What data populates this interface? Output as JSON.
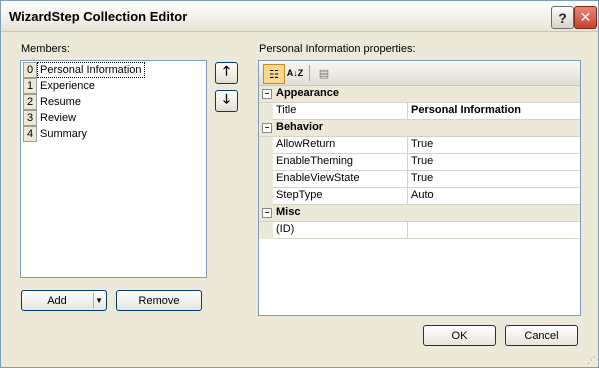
{
  "window": {
    "title": "WizardStep Collection Editor",
    "help_glyph": "?",
    "close_glyph": "✕"
  },
  "members": {
    "label": "Members:",
    "items": [
      {
        "index": "0",
        "name": "Personal Information"
      },
      {
        "index": "1",
        "name": "Experience"
      },
      {
        "index": "2",
        "name": "Resume"
      },
      {
        "index": "3",
        "name": "Review"
      },
      {
        "index": "4",
        "name": "Summary"
      }
    ]
  },
  "buttons": {
    "add": "Add",
    "remove": "Remove",
    "ok": "OK",
    "cancel": "Cancel",
    "up_glyph": "🡑",
    "down_glyph": "🡓"
  },
  "properties": {
    "label": "Personal Information properties:",
    "toolbar": {
      "cat_glyph": "☷",
      "az_glyph": "A↓Z",
      "pages_glyph": "▤"
    },
    "groups": [
      {
        "name": "Appearance",
        "rows": [
          {
            "name": "Title",
            "value": "Personal Information"
          }
        ]
      },
      {
        "name": "Behavior",
        "rows": [
          {
            "name": "AllowReturn",
            "value": "True"
          },
          {
            "name": "EnableTheming",
            "value": "True"
          },
          {
            "name": "EnableViewState",
            "value": "True"
          },
          {
            "name": "StepType",
            "value": "Auto"
          }
        ]
      },
      {
        "name": "Misc",
        "rows": [
          {
            "name": "(ID)",
            "value": ""
          }
        ]
      }
    ]
  }
}
